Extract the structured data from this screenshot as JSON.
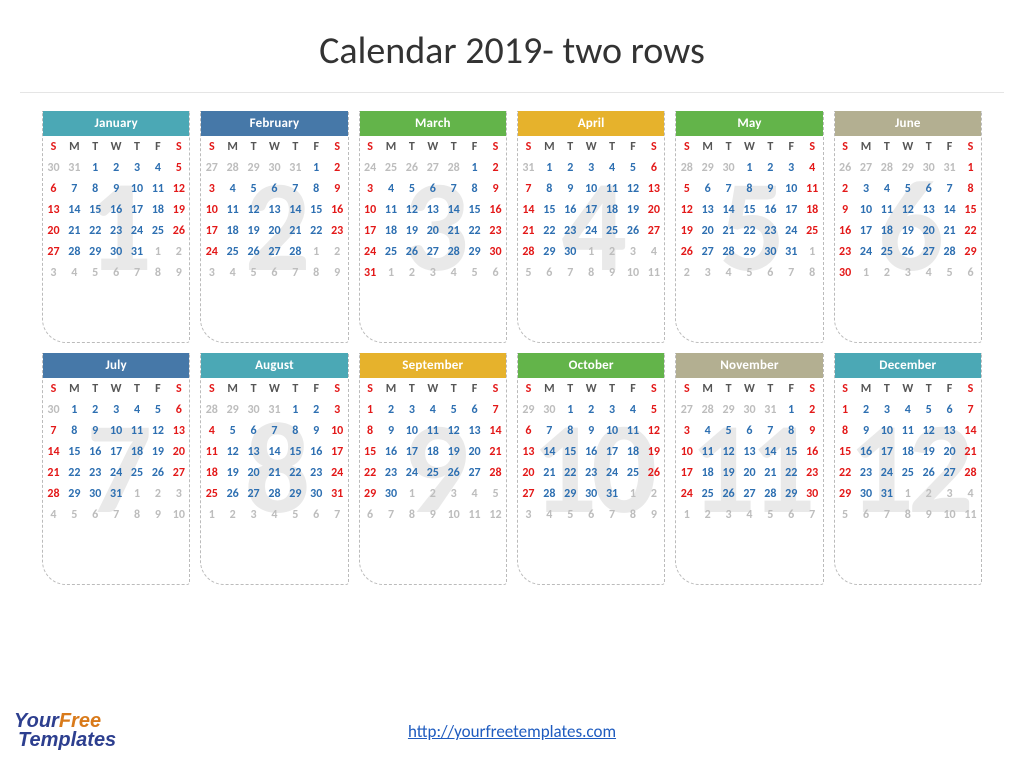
{
  "title": "Calendar 2019- two rows",
  "footer_url": "http://yourfreetemplates.com",
  "logo": {
    "your": "Your",
    "free": "Free",
    "templates": "Templates"
  },
  "dow": [
    "S",
    "M",
    "T",
    "W",
    "T",
    "F",
    "S"
  ],
  "months": [
    {
      "name": "January",
      "num": "1",
      "color": "#4ba8b5",
      "first_dow": 2,
      "days": 31,
      "prev_days": 31
    },
    {
      "name": "February",
      "num": "2",
      "color": "#4678a8",
      "first_dow": 5,
      "days": 28,
      "prev_days": 31
    },
    {
      "name": "March",
      "num": "3",
      "color": "#63b44a",
      "first_dow": 5,
      "days": 31,
      "prev_days": 28
    },
    {
      "name": "April",
      "num": "4",
      "color": "#e6b22c",
      "first_dow": 1,
      "days": 30,
      "prev_days": 31
    },
    {
      "name": "May",
      "num": "5",
      "color": "#63b44a",
      "first_dow": 3,
      "days": 31,
      "prev_days": 30
    },
    {
      "name": "June",
      "num": "6",
      "color": "#b3af91",
      "first_dow": 6,
      "days": 30,
      "prev_days": 31
    },
    {
      "name": "July",
      "num": "7",
      "color": "#4678a8",
      "first_dow": 1,
      "days": 31,
      "prev_days": 30
    },
    {
      "name": "August",
      "num": "8",
      "color": "#4ba8b5",
      "first_dow": 4,
      "days": 31,
      "prev_days": 31
    },
    {
      "name": "September",
      "num": "9",
      "color": "#e6b22c",
      "first_dow": 0,
      "days": 30,
      "prev_days": 31
    },
    {
      "name": "October",
      "num": "10",
      "color": "#63b44a",
      "first_dow": 2,
      "days": 31,
      "prev_days": 30
    },
    {
      "name": "November",
      "num": "11",
      "color": "#b3af91",
      "first_dow": 5,
      "days": 30,
      "prev_days": 31
    },
    {
      "name": "December",
      "num": "12",
      "color": "#4ba8b5",
      "first_dow": 0,
      "days": 31,
      "prev_days": 30
    }
  ]
}
